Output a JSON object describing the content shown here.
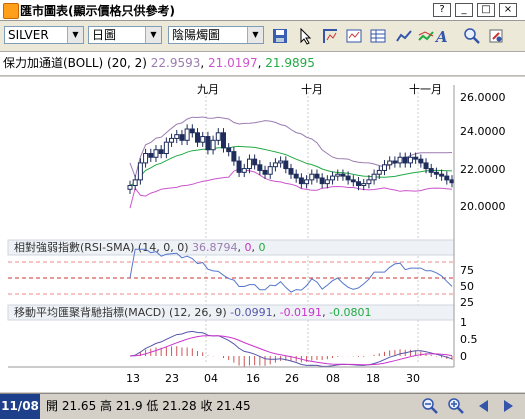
{
  "window": {
    "title": "匯市圖表(顯示價格只供參考)",
    "controls": [
      "?",
      "_",
      "□",
      "×"
    ]
  },
  "toolbar": {
    "symbol": "SILVER",
    "period": "日圖",
    "chart_style": "陰陽燭圖",
    "icons": [
      "save-icon",
      "cursor-icon",
      "crosshair-icon",
      "indicator-icon",
      "data-table-icon",
      "line-draw-icon",
      "chart-type-icon",
      "text-icon",
      "zoom-icon",
      "settings-icon"
    ]
  },
  "boll": {
    "label": "保力加通道(BOLL) (20, 2)",
    "upper": "22.9593",
    "mid": "21.0197",
    "lower": "21.9895",
    "upper_color": "#9b7bb0",
    "mid_color": "#cc55cc",
    "lower_color": "#22aa44"
  },
  "rsi": {
    "label": "相對強弱指數(RSI-SMA) (14, 0, 0)",
    "v1": "36.8794",
    "v2": "0",
    "v3": "0",
    "c1": "#9b7bb0",
    "c2": "#cc33cc",
    "c3": "#22aa44"
  },
  "macd": {
    "label": "移動平均匯聚背馳指標(MACD) (12, 26, 9)",
    "v1": "-0.0991",
    "v2": "-0.0191",
    "v3": "-0.0801",
    "c1": "#5555aa",
    "c2": "#cc33cc",
    "c3": "#22aa44"
  },
  "axis": {
    "price_ticks": [
      "26.0000",
      "24.0000",
      "22.0000",
      "20.0000"
    ],
    "rsi_ticks": [
      "75",
      "50",
      "25"
    ],
    "macd_ticks": [
      "1",
      "0.5",
      "0"
    ],
    "month_labels": [
      "九月",
      "十月",
      "十一月"
    ],
    "date_labels": [
      "13",
      "23",
      "04",
      "16",
      "26",
      "08",
      "18",
      "30"
    ]
  },
  "status": {
    "date": "11/08",
    "open_label": "開",
    "open": "21.65",
    "high_label": "高",
    "high": "21.9",
    "low_label": "低",
    "low": "21.28",
    "close_label": "收",
    "close": "21.45"
  },
  "chart_data": {
    "type": "candlestick",
    "symbol": "SILVER",
    "price_range": [
      19.5,
      26.5
    ],
    "close_series": [
      21.3,
      21.6,
      22.5,
      23.0,
      22.8,
      23.2,
      23.0,
      23.6,
      23.8,
      24.0,
      23.7,
      24.3,
      24.1,
      23.6,
      23.9,
      23.2,
      23.7,
      24.1,
      23.3,
      23.1,
      22.6,
      22.0,
      22.2,
      22.7,
      22.4,
      22.1,
      21.9,
      22.3,
      22.5,
      22.6,
      22.2,
      21.9,
      21.7,
      21.4,
      21.6,
      21.9,
      21.7,
      21.4,
      21.6,
      21.8,
      21.9,
      21.8,
      21.6,
      21.5,
      21.3,
      21.4,
      21.6,
      21.9,
      22.1,
      22.4,
      22.6,
      22.5,
      22.8,
      22.5,
      22.8,
      22.7,
      22.5,
      22.2,
      22.0,
      21.9,
      21.8,
      21.6,
      21.45
    ],
    "rsi_levels": [
      75,
      50,
      25
    ],
    "rsi_last": 36.8794,
    "macd_last": -0.0991,
    "macd_signal": -0.0191,
    "macd_hist": -0.0801
  }
}
